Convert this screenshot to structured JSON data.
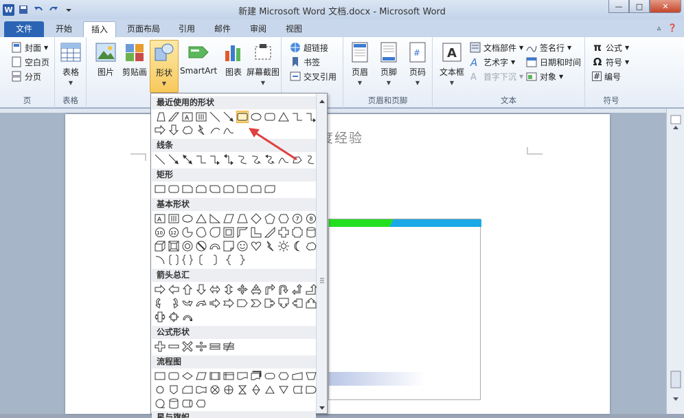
{
  "title_bar": {
    "title": "新建 Microsoft Word 文档.docx - Microsoft Word",
    "app_logo": "W",
    "minimize": "—",
    "maximize": "□",
    "close": "✕"
  },
  "tabs": [
    "文件",
    "开始",
    "插入",
    "页面布局",
    "引用",
    "邮件",
    "审阅",
    "视图"
  ],
  "active_tab": "插入",
  "ribbon": {
    "pages": {
      "cover": "封面",
      "blank": "空白页",
      "break": "分页",
      "label": "页"
    },
    "tables": {
      "table": "表格",
      "label": "表格"
    },
    "illustrations": {
      "picture": "图片",
      "clipart": "剪贴画",
      "shapes": "形状",
      "smartart": "SmartArt",
      "chart": "图表",
      "screenshot": "屏幕截图"
    },
    "links": {
      "hyperlink": "超链接",
      "bookmark": "书签",
      "crossref": "交叉引用"
    },
    "header_footer": {
      "header": "页眉",
      "footer": "页脚",
      "pagenum": "页码",
      "label": "页眉和页脚"
    },
    "text": {
      "textbox": "文本框",
      "quickparts": "文档部件",
      "wordart": "艺术字",
      "dropcap": "首字下沉",
      "signature": "签名行",
      "datetime": "日期和时间",
      "object": "对象",
      "label": "文本"
    },
    "symbols": {
      "equation": "公式",
      "symbol": "符号",
      "number": "编号",
      "label": "符号"
    }
  },
  "gallery": {
    "sections": [
      "最近使用的形状",
      "线条",
      "矩形",
      "基本形状",
      "箭头总汇",
      "公式形状",
      "流程图",
      "星与旗帜"
    ]
  },
  "document": {
    "visible_text": "度经验"
  },
  "colors": {
    "file_tab": "#2b64b5",
    "highlight": "#fbd77a",
    "annotation_arrow": "#e04040",
    "green_bar": "#22e020",
    "blue_bar": "#1aa9e6"
  }
}
